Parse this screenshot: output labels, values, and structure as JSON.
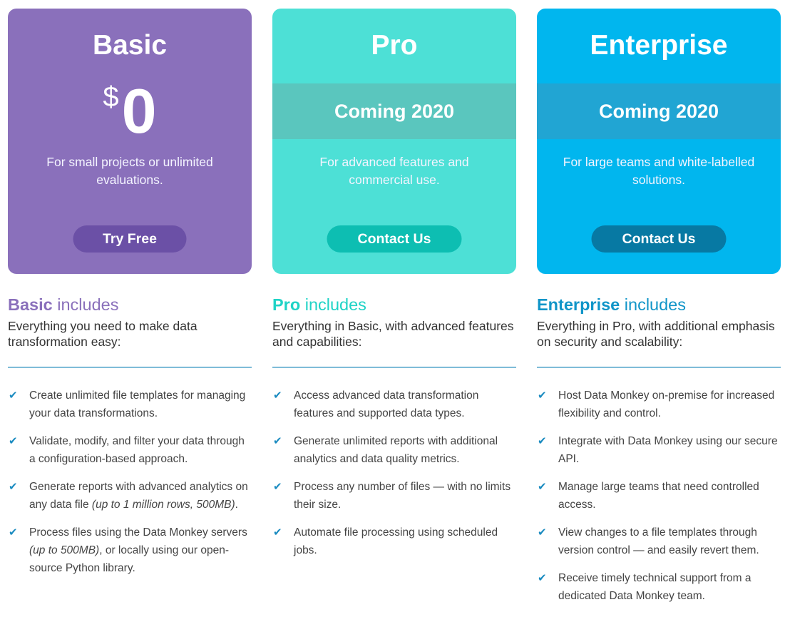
{
  "plans": [
    {
      "id": "basic",
      "title": "Basic",
      "price": {
        "currency": "$",
        "amount": "0"
      },
      "description": "For small projects or unlimited evaluations.",
      "cta_label": "Try Free",
      "includes_bold": "Basic",
      "includes_rest": " includes",
      "includes_subtitle": "Everything you need to make data transformation easy:",
      "features": [
        {
          "text": "Create unlimited file templates for managing your data transformations.",
          "note": "",
          "after": ""
        },
        {
          "text": "Validate, modify, and filter your data through a configuration-based approach.",
          "note": "",
          "after": ""
        },
        {
          "text": "Generate reports with advanced analytics on any data file ",
          "note": "(up to 1 million rows, 500MB)",
          "after": "."
        },
        {
          "text": "Process files using the Data Monkey servers ",
          "note": "(up to 500MB)",
          "after": ", or locally using our open-source Python library."
        }
      ]
    },
    {
      "id": "pro",
      "title": "Pro",
      "band": "Coming 2020",
      "description": "For advanced features and commercial use.",
      "cta_label": "Contact Us",
      "includes_bold": "Pro",
      "includes_rest": " includes",
      "includes_subtitle": "Everything in Basic, with advanced features and capabilities:",
      "features": [
        {
          "text": "Access advanced data transformation features and supported data types.",
          "note": "",
          "after": ""
        },
        {
          "text": "Generate unlimited reports with additional analytics and data quality metrics.",
          "note": "",
          "after": ""
        },
        {
          "text": "Process any number of files — with no limits their size.",
          "note": "",
          "after": ""
        },
        {
          "text": "Automate file processing using scheduled jobs.",
          "note": "",
          "after": ""
        }
      ]
    },
    {
      "id": "enterprise",
      "title": "Enterprise",
      "band": "Coming 2020",
      "description": "For large teams and white-labelled solutions.",
      "cta_label": "Contact Us",
      "includes_bold": "Enterprise",
      "includes_rest": " includes",
      "includes_subtitle": "Everything in Pro, with additional emphasis on security and scalability:",
      "features": [
        {
          "text": "Host Data Monkey on-premise for increased flexibility and control.",
          "note": "",
          "after": ""
        },
        {
          "text": "Integrate with Data Monkey using our secure API.",
          "note": "",
          "after": ""
        },
        {
          "text": "Manage large teams that need controlled access.",
          "note": "",
          "after": ""
        },
        {
          "text": "View changes to a file templates through version control — and easily revert them.",
          "note": "",
          "after": ""
        },
        {
          "text": "Receive timely technical support from a dedicated Data Monkey team.",
          "note": "",
          "after": ""
        }
      ]
    }
  ],
  "icons": {
    "check": "✔"
  },
  "colors": {
    "basic": "#8a70bb",
    "pro": "#4de0d6",
    "enterprise": "#01b6ee",
    "check": "#1a8bc0",
    "divider": "#7fbcd8"
  }
}
